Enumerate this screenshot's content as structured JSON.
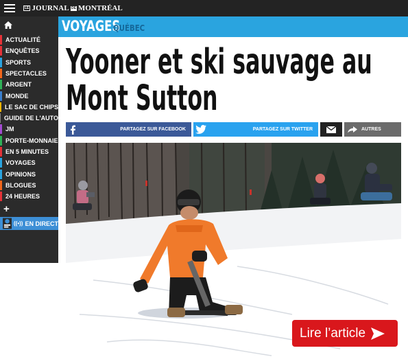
{
  "topbar": {
    "logo": {
      "le": "LE",
      "word1": "JOURNAL",
      "de": "DE",
      "word2": "MONTRÉAL"
    }
  },
  "sidebar": {
    "items": [
      {
        "label": "ACTUALITÉ",
        "color": "#e53238"
      },
      {
        "label": "ENQUÊTES",
        "color": "#e53238"
      },
      {
        "label": "SPORTS",
        "color": "#2aa4df"
      },
      {
        "label": "SPECTACLES",
        "color": "#f2661b"
      },
      {
        "label": "ARGENT",
        "color": "#2fb157"
      },
      {
        "label": "MONDE",
        "color": "#3a7fce"
      },
      {
        "label": "LE SAC DE CHIPS",
        "color": "#f0b400"
      },
      {
        "label": "GUIDE DE L'AUTO",
        "color": "#888888"
      },
      {
        "label": "JM",
        "color": "#a34bd0"
      },
      {
        "label": "PORTE-MONNAIE",
        "color": "#2fb157"
      },
      {
        "label": "EN 5 MINUTES",
        "color": "#e53238"
      },
      {
        "label": "VOYAGES",
        "color": "#2aa4df"
      },
      {
        "label": "OPINIONS",
        "color": "#2aa4df"
      },
      {
        "label": "BLOGUES",
        "color": "#f2661b"
      },
      {
        "label": "24 HEURES",
        "color": "#e53238"
      }
    ],
    "live_label": "EN DIRECT",
    "live_waves": "((•))"
  },
  "section": {
    "title": "VOYAGES",
    "subtitle": "QUÉBEC"
  },
  "article": {
    "headline_line1": "Yooner et ski sauvage au",
    "headline_line2": "Mont Sutton"
  },
  "share": {
    "facebook": "PARTAGEZ SUR FACEBOOK",
    "twitter": "PARTAGEZ SUR TWITTER",
    "other": "AUTRES"
  },
  "cta": {
    "label": "Lire l’article"
  },
  "icons": [
    "hamburger-icon",
    "home-icon",
    "plus-icon",
    "facebook-icon",
    "twitter-icon",
    "mail-icon",
    "share-arrow-icon",
    "arrow-right-icon"
  ],
  "colors": {
    "topbar": "#232323",
    "sidebar": "#2b2b2b",
    "section": "#2aa4df",
    "facebook": "#3b5998",
    "twitter": "#29a2ef",
    "cta": "#d9171c"
  }
}
